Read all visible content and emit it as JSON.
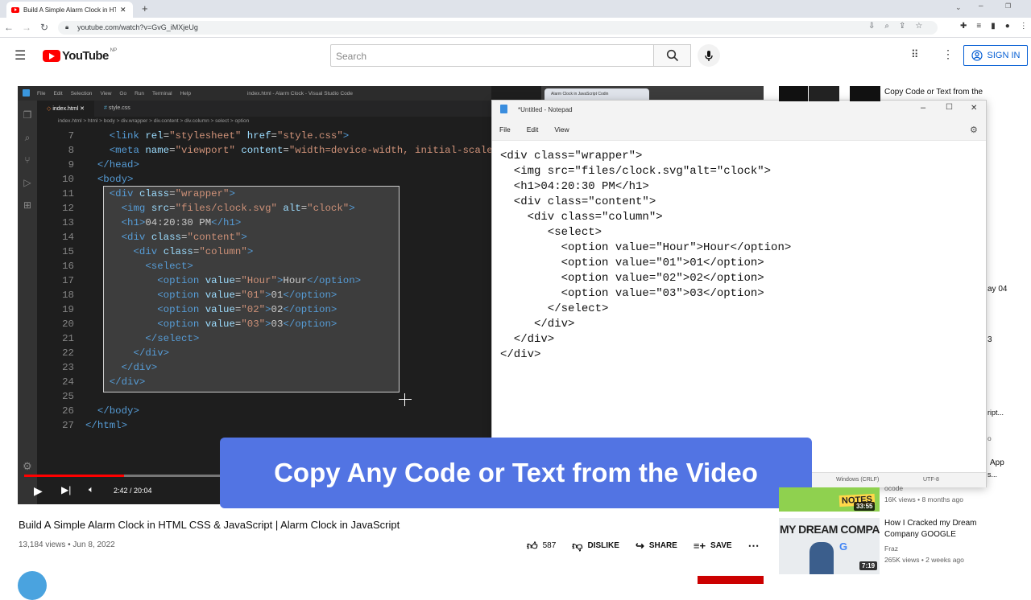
{
  "browser": {
    "tab_title": "Build A Simple Alarm Clock in HTM",
    "url": "youtube.com/watch?v=GvG_iMXjeUg"
  },
  "youtube": {
    "logo_text": "YouTube",
    "region": "NP",
    "search_placeholder": "Search",
    "signin_label": "SIGN IN"
  },
  "vscode": {
    "menu": [
      "File",
      "Edit",
      "Selection",
      "View",
      "Go",
      "Run",
      "Terminal",
      "Help"
    ],
    "window_title": "index.html - Alarm Clock - Visual Studio Code",
    "tabs": [
      "index.html",
      "style.css"
    ],
    "breadcrumb": "index.html > html > body > div.wrapper > div.content > div.column > select > option",
    "lines": [
      {
        "n": "7",
        "html": "    <span class='tag'>&lt;link</span> <span class='attr'>rel</span>=<span class='str'>\"stylesheet\"</span> <span class='attr'>href</span>=<span class='str'>\"style.css\"</span><span class='tag'>&gt;</span>"
      },
      {
        "n": "8",
        "html": "    <span class='tag'>&lt;meta</span> <span class='attr'>name</span>=<span class='str'>\"viewport\"</span> <span class='attr'>content</span>=<span class='str'>\"width=device-width, initial-scale=</span>"
      },
      {
        "n": "9",
        "html": "  <span class='tag'>&lt;/head&gt;</span>"
      },
      {
        "n": "10",
        "html": "  <span class='tag'>&lt;body&gt;</span>"
      },
      {
        "n": "11",
        "html": "    <span class='tag'>&lt;div</span> <span class='attr'>class</span>=<span class='str'>\"wrapper\"</span><span class='tag'>&gt;</span>"
      },
      {
        "n": "12",
        "html": "      <span class='tag'>&lt;img</span> <span class='attr'>src</span>=<span class='str'>\"files/clock.svg\"</span> <span class='attr'>alt</span>=<span class='str'>\"clock\"</span><span class='tag'>&gt;</span>"
      },
      {
        "n": "13",
        "html": "      <span class='tag'>&lt;h1&gt;</span>04:20:30 PM<span class='tag'>&lt;/h1&gt;</span>"
      },
      {
        "n": "14",
        "html": "      <span class='tag'>&lt;div</span> <span class='attr'>class</span>=<span class='str'>\"content\"</span><span class='tag'>&gt;</span>"
      },
      {
        "n": "15",
        "html": "        <span class='tag'>&lt;div</span> <span class='attr'>class</span>=<span class='str'>\"column\"</span><span class='tag'>&gt;</span>"
      },
      {
        "n": "16",
        "html": "          <span class='tag'>&lt;select&gt;</span>"
      },
      {
        "n": "17",
        "html": "            <span class='tag'>&lt;option</span> <span class='attr'>value</span>=<span class='str'>\"Hour\"</span><span class='tag'>&gt;</span>Hour<span class='tag'>&lt;/option&gt;</span>"
      },
      {
        "n": "18",
        "html": "            <span class='tag'>&lt;option</span> <span class='attr'>value</span>=<span class='str'>\"01\"</span><span class='tag'>&gt;</span>01<span class='tag'>&lt;/option&gt;</span>"
      },
      {
        "n": "19",
        "html": "            <span class='tag'>&lt;option</span> <span class='attr'>value</span>=<span class='str'>\"02\"</span><span class='tag'>&gt;</span>02<span class='tag'>&lt;/option&gt;</span>"
      },
      {
        "n": "20",
        "html": "            <span class='tag'>&lt;option</span> <span class='attr'>value</span>=<span class='str'>\"03\"</span><span class='tag'>&gt;</span>03<span class='tag'>&lt;/option&gt;</span>"
      },
      {
        "n": "21",
        "html": "          <span class='tag'>&lt;/select&gt;</span>"
      },
      {
        "n": "22",
        "html": "        <span class='tag'>&lt;/div&gt;</span>"
      },
      {
        "n": "23",
        "html": "      <span class='tag'>&lt;/div&gt;</span>"
      },
      {
        "n": "24",
        "html": "    <span class='tag'>&lt;/div&gt;</span>"
      },
      {
        "n": "25",
        "html": ""
      },
      {
        "n": "26",
        "html": "  <span class='tag'>&lt;/body&gt;</span>"
      },
      {
        "n": "27",
        "html": "<span class='tag'>&lt;/html&gt;</span>"
      }
    ],
    "browser_tab": "Alarm Clock in JavaScript Codin"
  },
  "notepad": {
    "title": "*Untitled - Notepad",
    "menu": [
      "File",
      "Edit",
      "View"
    ],
    "text": "<div class=\"wrapper\">\n  <img src=\"files/clock.svg\"alt=\"clock\">\n  <h1>04:20:30 PM</h1>\n  <div class=\"content\">\n    <div class=\"column\">\n       <select>\n         <option value=\"Hour\">Hour</option>\n         <option value=\"01\">01</option>\n         <option value=\"02\">02</option>\n         <option value=\"03\">03</option>\n       </select>\n     </div>\n  </div>\n</div>",
    "status_eol": "Windows (CRLF)",
    "status_enc": "UTF-8"
  },
  "banner": "Copy Any Code or Text from the Video",
  "player": {
    "time": "2:42 / 20:04",
    "progress_fraction": 0.135
  },
  "video": {
    "title": "Build A Simple Alarm Clock in HTML CSS & JavaScript | Alarm Clock in JavaScript",
    "meta": "13,184 views • Jun 8, 2022",
    "likes": "587",
    "dislike": "DISLIKE",
    "share": "SHARE",
    "save": "SAVE"
  },
  "sidebar": [
    {
      "title": "Copy Code or Text from the",
      "channel": "",
      "meta": "",
      "duration": ""
    },
    {
      "title": "",
      "channel": "",
      "meta": "16K views • 8 months ago",
      "duration": "33:55",
      "channel_partial": "ocode",
      "thumb_text": "NOTES"
    },
    {
      "title": "How I Cracked my Dream Company GOOGLE",
      "channel": "Fraz",
      "meta": "265K views • 2 weeks ago",
      "duration": "7:19",
      "thumb_text": "MY DREAM COMPANY"
    }
  ],
  "sidebar_fragments": [
    "ay 04",
    "3",
    "ript...",
    "o",
    "App",
    "s..."
  ],
  "colors": {
    "yt_red": "#ff0000",
    "banner_blue": "#5274e3",
    "link_blue": "#065fd4"
  }
}
